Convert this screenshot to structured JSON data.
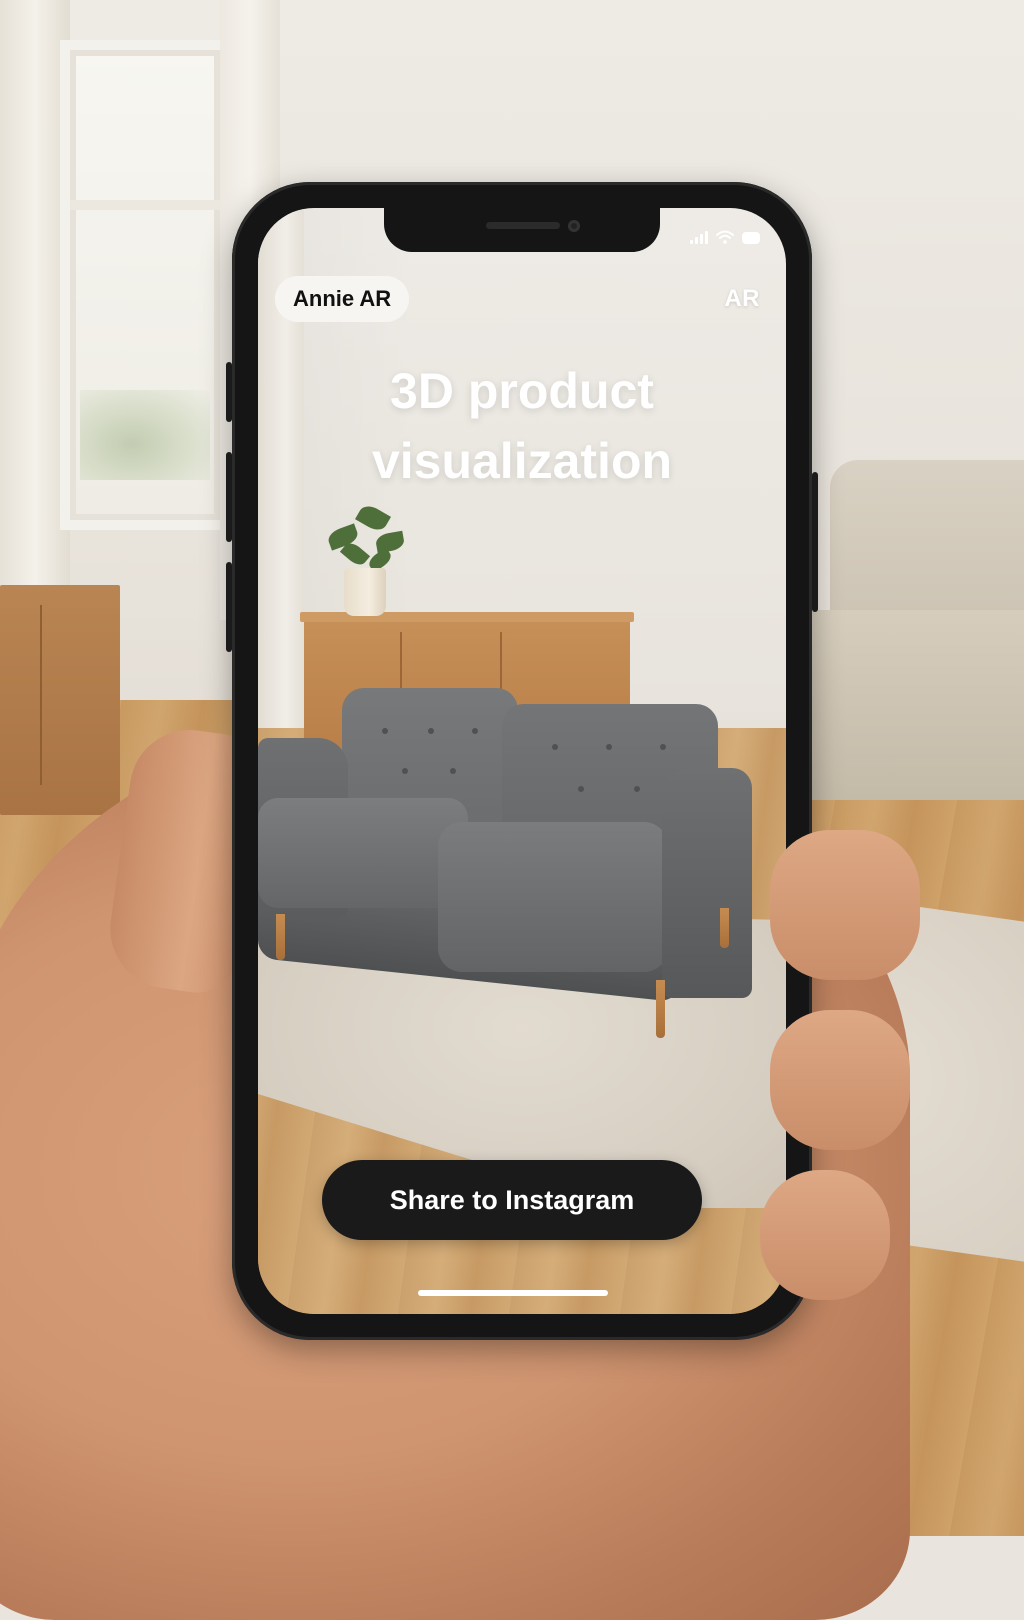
{
  "app": {
    "brand_badge": "Annie AR",
    "mode_label": "AR"
  },
  "headline": {
    "line1": "3D product",
    "line2": "visualization"
  },
  "actions": {
    "share_label": "Share to Instagram"
  },
  "status_bar": {
    "icons": [
      "cellular-signal-icon",
      "wifi-icon",
      "battery-icon"
    ]
  },
  "colors": {
    "button_bg": "#1a1a1a",
    "badge_bg": "#f6f5f2",
    "headline_text": "#ffffff",
    "sofa_fabric": "#6f7173"
  }
}
